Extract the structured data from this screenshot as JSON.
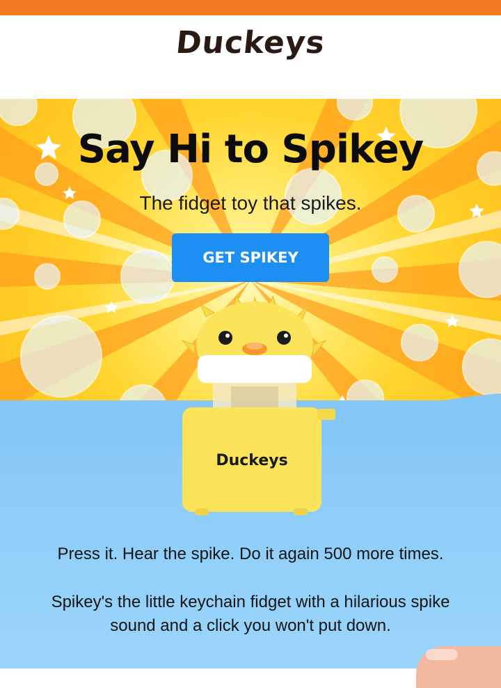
{
  "brand": {
    "logo_text": "Duckeys"
  },
  "hero": {
    "title": "Say Hi to Spikey",
    "subtitle": "The fidget toy that spikes.",
    "cta_label": "GET SPIKEY"
  },
  "product": {
    "box_label": "Duckeys"
  },
  "body": {
    "tagline": "Press it. Hear the spike. Do it again 500 more times.",
    "description": "Spikey's the little keychain fidget with a hilarious spike sound and a click you won't put down."
  },
  "colors": {
    "top_bar": "#f47a20",
    "cta": "#1e8ff2",
    "hero_yellow": "#ffd52e",
    "sky_blue": "#8dcdf8",
    "product_yellow": "#fbe35a"
  }
}
